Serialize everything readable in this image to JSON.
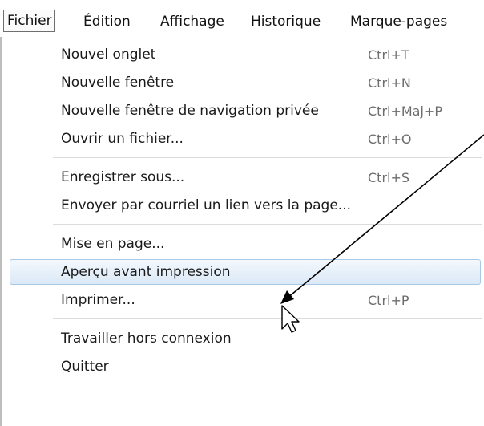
{
  "menubar": {
    "titles": [
      "Fichier",
      "Édition",
      "Affichage",
      "Historique",
      "Marque-pages"
    ],
    "active": "Fichier"
  },
  "menu": {
    "items": [
      {
        "label": "Nouvel onglet",
        "shortcut": "Ctrl+T"
      },
      {
        "label": "Nouvelle fenêtre",
        "shortcut": "Ctrl+N"
      },
      {
        "label": "Nouvelle fenêtre de navigation privée",
        "shortcut": "Ctrl+Maj+P"
      },
      {
        "label": "Ouvrir un fichier...",
        "shortcut": "Ctrl+O"
      },
      {
        "label": "Enregistrer sous...",
        "shortcut": "Ctrl+S"
      },
      {
        "label": "Envoyer par courriel un lien vers la page...",
        "shortcut": ""
      },
      {
        "label": "Mise en page...",
        "shortcut": ""
      },
      {
        "label": "Aperçu avant impression",
        "shortcut": ""
      },
      {
        "label": "Imprimer...",
        "shortcut": "Ctrl+P"
      },
      {
        "label": "Travailler hors connexion",
        "shortcut": ""
      },
      {
        "label": "Quitter",
        "shortcut": ""
      }
    ],
    "hovered_item": "Aperçu avant impression"
  },
  "colors": {
    "highlight_border": "#a9c8e6",
    "highlight_fill": "#dbe9f7",
    "shortcut_text": "#6d6d6d",
    "annotation_arrow": "#000000"
  },
  "icons": [
    "mouse-pointer-icon",
    "annotation-arrow"
  ]
}
